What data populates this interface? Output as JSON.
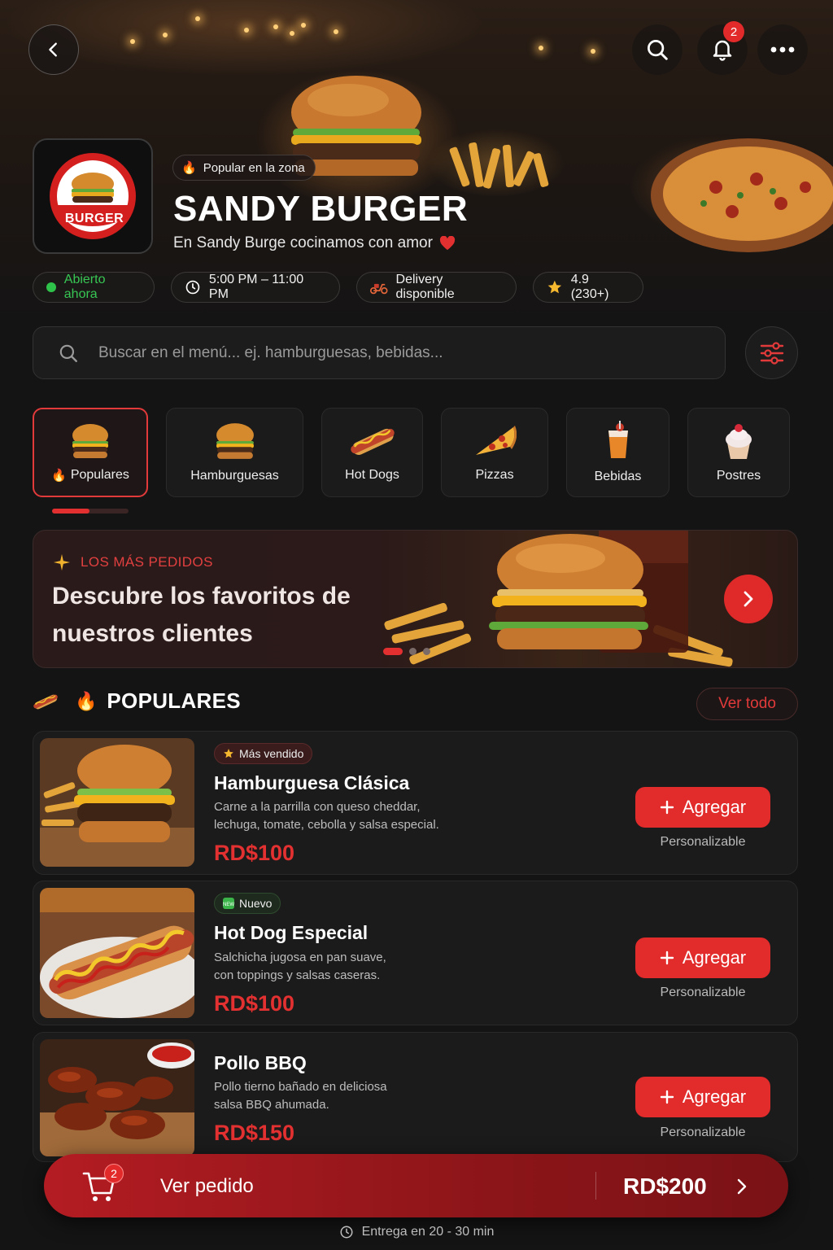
{
  "header": {
    "back_icon": "chevron-left-icon",
    "search_icon": "search-icon",
    "bell_icon": "bell-icon",
    "notification_count": "2",
    "more_icon": "more-horizontal-icon"
  },
  "restaurant": {
    "logo_text": "BURGER",
    "popular_badge": "Popular en la zona",
    "name": "SANDY BURGER",
    "tagline": "En Sandy Burge cocinamos con amor",
    "status": "Abierto ahora",
    "hours": "5:00 PM – 11:00 PM",
    "delivery": "Delivery disponible",
    "rating": "4.9 (230+)"
  },
  "search": {
    "placeholder": "Buscar en el menú... ej. hamburguesas, bebidas..."
  },
  "categories": [
    {
      "label": "Populares",
      "active": true
    },
    {
      "label": "Hamburguesas"
    },
    {
      "label": "Hot Dogs"
    },
    {
      "label": "Pizzas"
    },
    {
      "label": "Bebidas"
    },
    {
      "label": "Postres"
    }
  ],
  "banner": {
    "eyebrow": "LOS MÁS PEDIDOS",
    "title": "Descubre los favoritos de nuestros clientes",
    "slides": 3,
    "active_slide": 1
  },
  "section": {
    "title": "POPULARES",
    "see_all": "Ver todo"
  },
  "products": [
    {
      "badge": "Más vendido",
      "name": "Hamburguesa Clásica",
      "desc_line1": "Carne a la parrilla con queso cheddar,",
      "desc_line2": "lechuga, tomate, cebolla y salsa especial.",
      "price": "RD$100",
      "add_label": "Agregar",
      "note": "Personalizable"
    },
    {
      "badge": "Nuevo",
      "name": "Hot Dog Especial",
      "desc_line1": "Salchicha jugosa en pan suave,",
      "desc_line2": "con toppings y salsas caseras.",
      "price": "RD$100",
      "add_label": "Agregar",
      "note": "Personalizable"
    },
    {
      "name": "Pollo BBQ",
      "desc_line1": "Pollo tierno bañado en deliciosa",
      "desc_line2": "salsa BBQ ahumada.",
      "price": "RD$150",
      "add_label": "Agregar",
      "note": "Personalizable"
    }
  ],
  "order": {
    "cart_count": "2",
    "label": "Ver pedido",
    "total": "RD$200",
    "eta": "Entrega en 20 - 30 min"
  },
  "colors": {
    "accent": "#e22b2b",
    "background": "#151414",
    "open_status": "#2fc24a"
  }
}
